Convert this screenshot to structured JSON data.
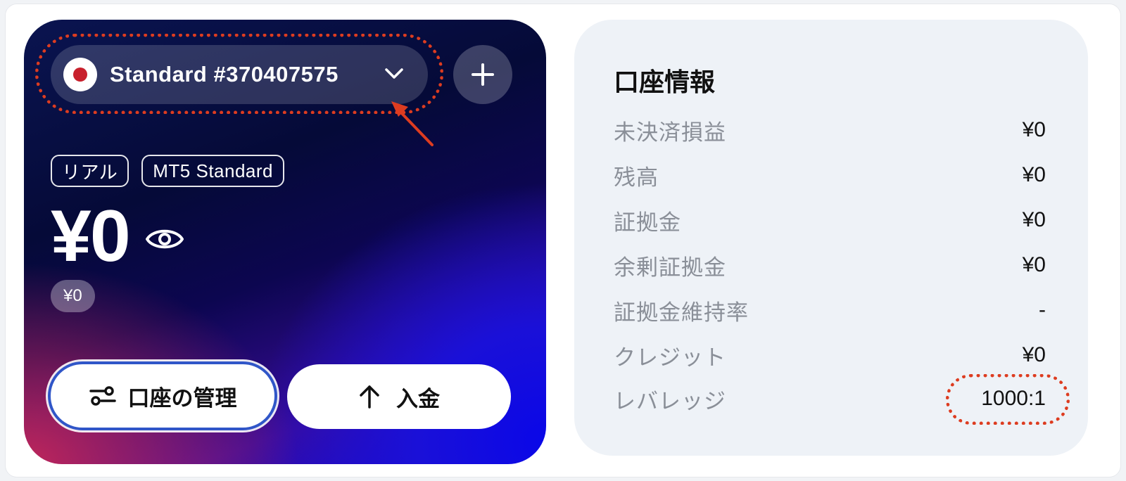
{
  "account_card": {
    "account_name": "Standard #370407575",
    "badges": [
      "リアル",
      "MT5 Standard"
    ],
    "balance": "¥0",
    "sub_balance": "¥0",
    "manage_label": "口座の管理",
    "deposit_label": "入金",
    "icons": {
      "flag": "japan-flag-icon",
      "selector": "chevron-down-icon",
      "add": "plus-icon",
      "visibility": "eye-icon",
      "manage": "sliders-icon",
      "deposit": "arrow-up-icon"
    }
  },
  "info_panel": {
    "title": "口座情報",
    "rows": [
      {
        "label": "未決済損益",
        "value": "¥0"
      },
      {
        "label": "残高",
        "value": "¥0"
      },
      {
        "label": "証拠金",
        "value": "¥0"
      },
      {
        "label": "余剰証拠金",
        "value": "¥0"
      },
      {
        "label": "証拠金維持率",
        "value": "-"
      },
      {
        "label": "クレジット",
        "value": "¥0"
      },
      {
        "label": "レバレッジ",
        "value": "1000:1"
      }
    ]
  },
  "colors": {
    "annotation": "#dd3c20",
    "flag_red": "#c8202c",
    "button_outline": "#3056c8",
    "panel_bg": "#eef2f7"
  }
}
